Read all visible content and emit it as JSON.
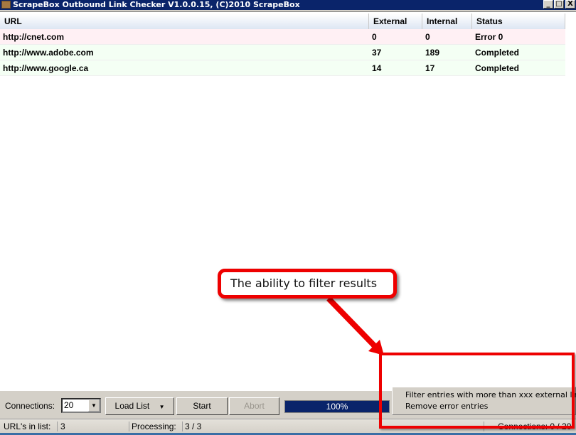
{
  "window": {
    "title": "ScrapeBox Outbound Link Checker V1.0.0.15, (C)2010 ScrapeBox",
    "minimize_label": "_",
    "maximize_label": "□",
    "close_label": "X"
  },
  "table": {
    "columns": [
      "URL",
      "External",
      "Internal",
      "Status"
    ],
    "rows": [
      {
        "url": "http://cnet.com",
        "external": "0",
        "internal": "0",
        "status": "Error 0",
        "state": "error"
      },
      {
        "url": "http://www.adobe.com",
        "external": "37",
        "internal": "189",
        "status": "Completed",
        "state": "ok"
      },
      {
        "url": "http://www.google.ca",
        "external": "14",
        "internal": "17",
        "status": "Completed",
        "state": "ok"
      }
    ]
  },
  "toolbar": {
    "connections_label": "Connections:",
    "connections_value": "20",
    "load_list_label": "Load List",
    "start_label": "Start",
    "abort_label": "Abort",
    "progress_percent": 100,
    "progress_label": "100%"
  },
  "context_menu": {
    "items": [
      "Filter entries with more than xxx external links",
      "Remove error entries"
    ]
  },
  "statusbar": {
    "urls_label": "URL's in list:",
    "urls_value": "3",
    "processing_label": "Processing:",
    "processing_value": "3 / 3",
    "connections_text": "Connections: 0 / 20"
  },
  "annotation": {
    "callout_text": "The ability to filter results",
    "color": "#ee0000"
  }
}
